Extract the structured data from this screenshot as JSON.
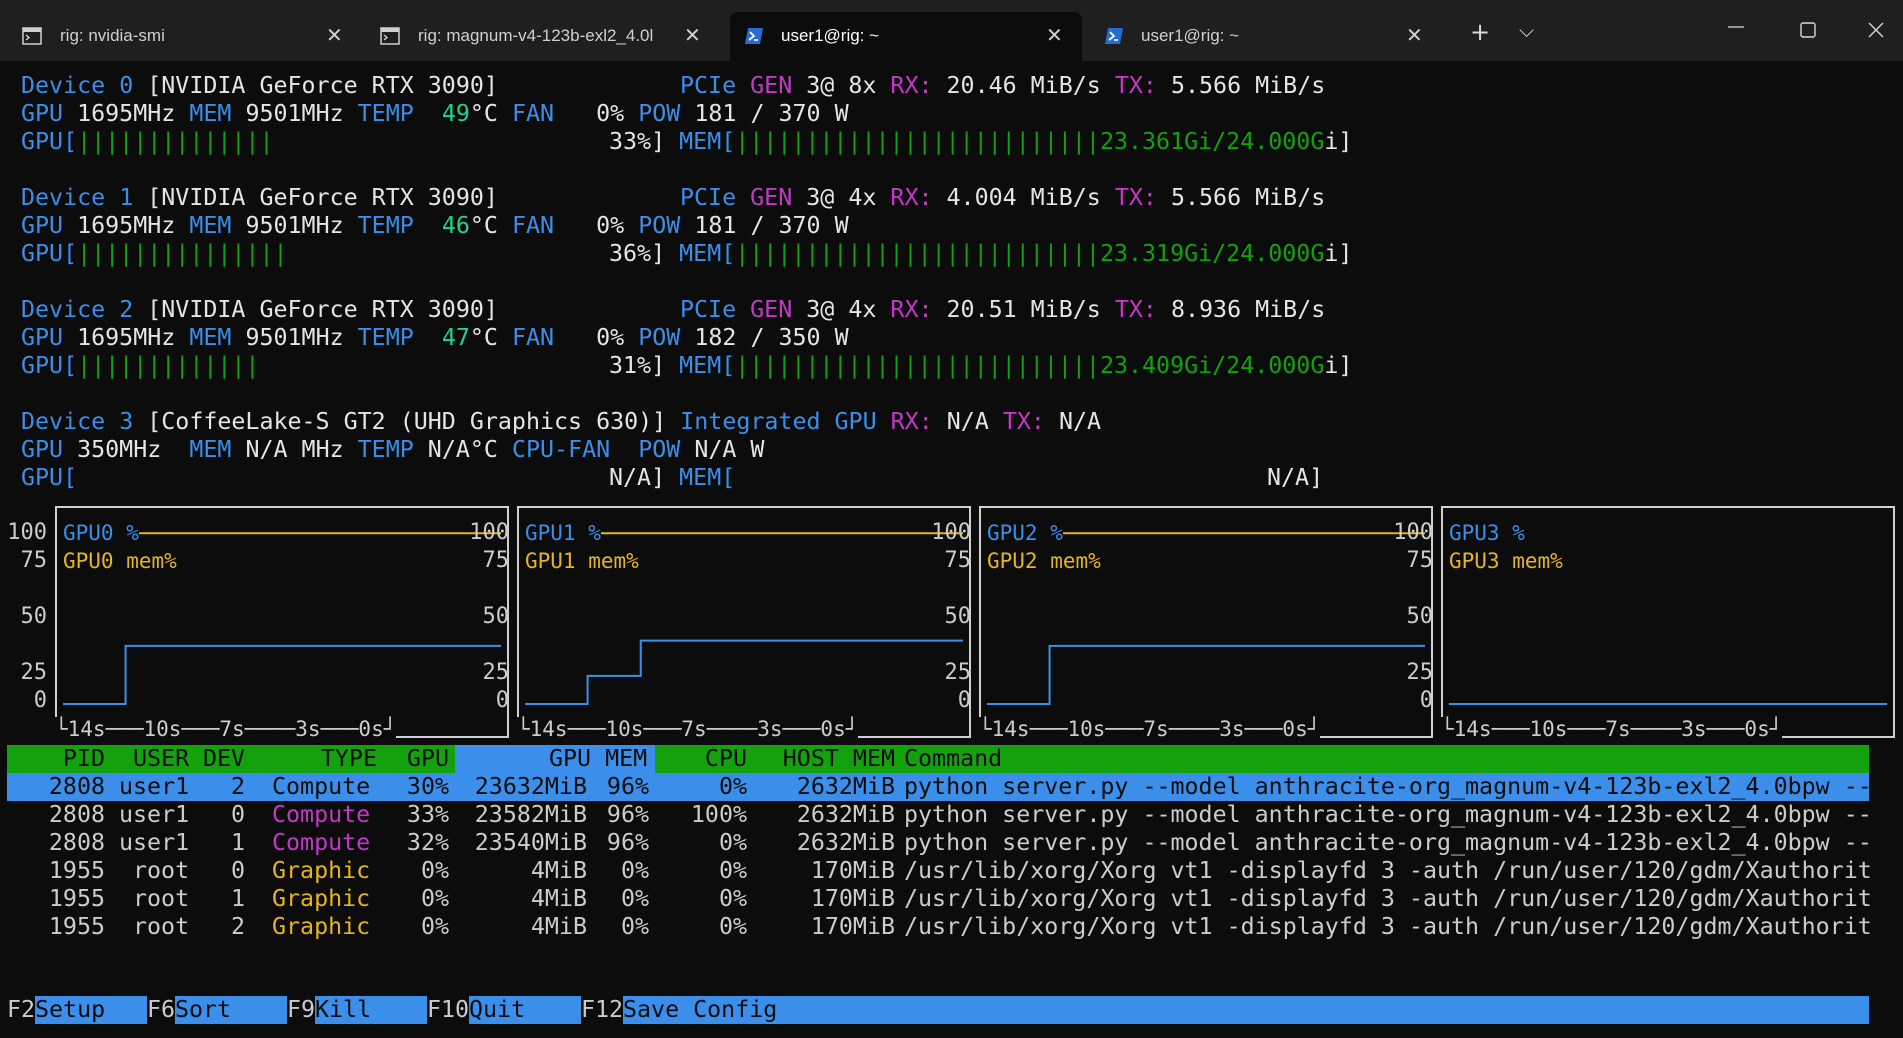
{
  "tabs": [
    {
      "title": "rig: nvidia-smi",
      "icon": "terminal-icon"
    },
    {
      "title": "rig: magnum-v4-123b-exl2_4.0l",
      "icon": "terminal-icon"
    },
    {
      "title": "user1@rig: ~",
      "icon": "powershell-icon",
      "active": true
    },
    {
      "title": "user1@rig: ~",
      "icon": "powershell-icon"
    }
  ],
  "new_tab_label": "+",
  "dropdown_label": "⌵",
  "devices": [
    {
      "device_label": "Device",
      "index": "0",
      "name": "[NVIDIA GeForce RTX 3090]",
      "pcie_label": "PCIe",
      "gen_label": "GEN",
      "gen_value": "3@ 8x",
      "rx_label": "RX:",
      "rx": "20.46 MiB/s",
      "tx_label": "TX:",
      "tx": "5.566 MiB/s",
      "gpu_label": "GPU",
      "gpu_clock": "1695MHz",
      "mem_label": "MEM",
      "mem_clock": "9501MHz",
      "temp_label": "TEMP",
      "temp": "49",
      "temp_unit": "°C",
      "fan_label": "FAN",
      "fan": "0%",
      "pow_label": "POW",
      "pow": "181 / 370 W",
      "gpu_bar_open": "GPU[",
      "gpu_bar": "||||||||||||||",
      "gpu_pct": "33%]",
      "mem_bar_open": "MEM[",
      "mem_bar": "||||||||||||||||||||||||||",
      "mem_used": "23.361Gi/24.000G",
      "mem_close": "i]"
    },
    {
      "device_label": "Device",
      "index": "1",
      "name": "[NVIDIA GeForce RTX 3090]",
      "pcie_label": "PCIe",
      "gen_label": "GEN",
      "gen_value": "3@ 4x",
      "rx_label": "RX:",
      "rx": "4.004 MiB/s",
      "tx_label": "TX:",
      "tx": "5.566 MiB/s",
      "gpu_label": "GPU",
      "gpu_clock": "1695MHz",
      "mem_label": "MEM",
      "mem_clock": "9501MHz",
      "temp_label": "TEMP",
      "temp": "46",
      "temp_unit": "°C",
      "fan_label": "FAN",
      "fan": "0%",
      "pow_label": "POW",
      "pow": "181 / 370 W",
      "gpu_bar_open": "GPU[",
      "gpu_bar": "|||||||||||||||",
      "gpu_pct": "36%]",
      "mem_bar_open": "MEM[",
      "mem_bar": "||||||||||||||||||||||||||",
      "mem_used": "23.319Gi/24.000G",
      "mem_close": "i]"
    },
    {
      "device_label": "Device",
      "index": "2",
      "name": "[NVIDIA GeForce RTX 3090]",
      "pcie_label": "PCIe",
      "gen_label": "GEN",
      "gen_value": "3@ 4x",
      "rx_label": "RX:",
      "rx": "20.51 MiB/s",
      "tx_label": "TX:",
      "tx": "8.936 MiB/s",
      "gpu_label": "GPU",
      "gpu_clock": "1695MHz",
      "mem_label": "MEM",
      "mem_clock": "9501MHz",
      "temp_label": "TEMP",
      "temp": "47",
      "temp_unit": "°C",
      "fan_label": "FAN",
      "fan": "0%",
      "pow_label": "POW",
      "pow": "182 / 350 W",
      "gpu_bar_open": "GPU[",
      "gpu_bar": "|||||||||||||",
      "gpu_pct": "31%]",
      "mem_bar_open": "MEM[",
      "mem_bar": "||||||||||||||||||||||||||",
      "mem_used": "23.409Gi/24.000G",
      "mem_close": "i]"
    }
  ],
  "device3": {
    "device_label": "Device",
    "index": "3",
    "name": "[CoffeeLake-S GT2 (UHD Graphics 630)]",
    "integrated": "Integrated GPU",
    "rx_label": "RX:",
    "rx": "N/A",
    "tx_label": "TX:",
    "tx": "N/A",
    "gpu_label": "GPU",
    "gpu_clock": "350MHz",
    "mem_label": "MEM",
    "mem_clock": "N/A MHz",
    "temp_label": "TEMP",
    "temp": "N/A°C",
    "fan_label": "CPU-FAN",
    "pow_label": "POW",
    "pow": "N/A W",
    "gpu_bar_open": "GPU[",
    "gpu_pct": "N/A]",
    "mem_bar_open": "MEM[",
    "mem_value": "N/A]"
  },
  "graphs": [
    {
      "util_label": "GPU0 %",
      "mem_label": "GPU0 mem%"
    },
    {
      "util_label": "GPU1 %",
      "mem_label": "GPU1 mem%"
    },
    {
      "util_label": "GPU2 %",
      "mem_label": "GPU2 mem%"
    },
    {
      "util_label": "GPU3 %",
      "mem_label": "GPU3 mem%"
    }
  ],
  "graph_ticks": [
    "100",
    "75",
    "50",
    "25",
    "0"
  ],
  "graph_xaxis": "└14s───10s───7s────3s───0s┘",
  "colors": {
    "util": "#3b8eea",
    "mem": "#e5b520",
    "header_bg": "#13a10e",
    "selected_bg": "#3b8eea"
  },
  "chart_data": [
    {
      "type": "line",
      "x": [
        -14,
        -12,
        -12,
        0
      ],
      "series": [
        {
          "name": "GPU0 %",
          "values": [
            0,
            0,
            33,
            33
          ]
        },
        {
          "name": "GPU0 mem%",
          "values": [
            97,
            97,
            97,
            97
          ]
        }
      ],
      "ylim": [
        0,
        100
      ],
      "x_ticks": [
        "14s",
        "10s",
        "7s",
        "3s",
        "0s"
      ]
    },
    {
      "type": "line",
      "x": [
        -14,
        -12,
        -12,
        -10.3,
        -10.3,
        0
      ],
      "series": [
        {
          "name": "GPU1 %",
          "values": [
            0,
            0,
            16,
            16,
            36,
            36
          ]
        },
        {
          "name": "GPU1 mem%",
          "values": [
            97,
            97,
            97,
            97,
            97,
            97
          ]
        }
      ],
      "ylim": [
        0,
        100
      ],
      "x_ticks": [
        "14s",
        "10s",
        "7s",
        "3s",
        "0s"
      ]
    },
    {
      "type": "line",
      "x": [
        -14,
        -12,
        -12,
        0
      ],
      "series": [
        {
          "name": "GPU2 %",
          "values": [
            0,
            0,
            33,
            33
          ]
        },
        {
          "name": "GPU2 mem%",
          "values": [
            97,
            97,
            97,
            97
          ]
        }
      ],
      "ylim": [
        0,
        100
      ],
      "x_ticks": [
        "14s",
        "10s",
        "7s",
        "3s",
        "0s"
      ]
    },
    {
      "type": "line",
      "x": [
        -14,
        0
      ],
      "series": [
        {
          "name": "GPU3 %",
          "values": [
            0,
            0
          ]
        },
        {
          "name": "GPU3 mem%",
          "values": [
            0,
            0
          ]
        }
      ],
      "ylim": [
        0,
        100
      ],
      "x_ticks": [
        "14s",
        "10s",
        "7s",
        "3s",
        "0s"
      ]
    }
  ],
  "proc_headers": {
    "pid": "PID",
    "user": "USER",
    "dev": "DEV",
    "type": "TYPE",
    "gpu": "GPU",
    "gpu_mem": "GPU MEM",
    "cpu": "CPU",
    "host_mem": "HOST MEM",
    "command": "Command"
  },
  "processes": [
    {
      "pid": "2808",
      "user": "user1",
      "dev": "2",
      "type": "Compute",
      "gpu": "30%",
      "gpu_mem": "23632MiB",
      "mem": "96%",
      "cpu": "0%",
      "host_mem": "2632MiB",
      "command": "python server.py --model anthracite-org_magnum-v4-123b-exl2_4.0bpw --",
      "selected": true
    },
    {
      "pid": "2808",
      "user": "user1",
      "dev": "0",
      "type": "Compute",
      "gpu": "33%",
      "gpu_mem": "23582MiB",
      "mem": "96%",
      "cpu": "100%",
      "host_mem": "2632MiB",
      "command": "python server.py --model anthracite-org_magnum-v4-123b-exl2_4.0bpw --"
    },
    {
      "pid": "2808",
      "user": "user1",
      "dev": "1",
      "type": "Compute",
      "gpu": "32%",
      "gpu_mem": "23540MiB",
      "mem": "96%",
      "cpu": "0%",
      "host_mem": "2632MiB",
      "command": "python server.py --model anthracite-org_magnum-v4-123b-exl2_4.0bpw --"
    },
    {
      "pid": "1955",
      "user": "root",
      "dev": "0",
      "type": "Graphic",
      "gpu": "0%",
      "gpu_mem": "4MiB",
      "mem": "0%",
      "cpu": "0%",
      "host_mem": "170MiB",
      "command": "/usr/lib/xorg/Xorg vt1 -displayfd 3 -auth /run/user/120/gdm/Xauthorit"
    },
    {
      "pid": "1955",
      "user": "root",
      "dev": "1",
      "type": "Graphic",
      "gpu": "0%",
      "gpu_mem": "4MiB",
      "mem": "0%",
      "cpu": "0%",
      "host_mem": "170MiB",
      "command": "/usr/lib/xorg/Xorg vt1 -displayfd 3 -auth /run/user/120/gdm/Xauthorit"
    },
    {
      "pid": "1955",
      "user": "root",
      "dev": "2",
      "type": "Graphic",
      "gpu": "0%",
      "gpu_mem": "4MiB",
      "mem": "0%",
      "cpu": "0%",
      "host_mem": "170MiB",
      "command": "/usr/lib/xorg/Xorg vt1 -displayfd 3 -auth /run/user/120/gdm/Xauthorit"
    }
  ],
  "function_keys": [
    {
      "key": "F2",
      "label": "Setup"
    },
    {
      "key": "F6",
      "label": "Sort"
    },
    {
      "key": "F9",
      "label": "Kill"
    },
    {
      "key": "F10",
      "label": "Quit"
    },
    {
      "key": "F12",
      "label": "Save Config"
    }
  ]
}
